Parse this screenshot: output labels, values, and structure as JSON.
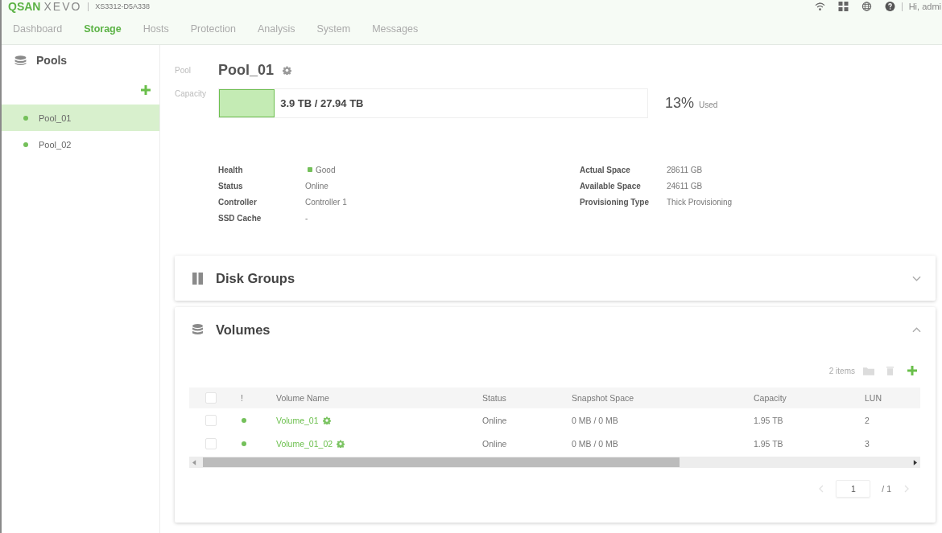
{
  "header": {
    "brand": "QSAN",
    "product": "XEVO",
    "serial": "XS3312-D5A338",
    "user": "Hi, admi"
  },
  "tabs": [
    {
      "label": "Dashboard",
      "selected": false
    },
    {
      "label": "Storage",
      "selected": true
    },
    {
      "label": "Hosts",
      "selected": false
    },
    {
      "label": "Protection",
      "selected": false
    },
    {
      "label": "Analysis",
      "selected": false
    },
    {
      "label": "System",
      "selected": false
    },
    {
      "label": "Messages",
      "selected": false
    }
  ],
  "sidebar": {
    "title": "Pools",
    "items": [
      {
        "label": "Pool_01",
        "selected": true,
        "color": "#74c05a"
      },
      {
        "label": "Pool_02",
        "selected": false,
        "color": "#74c05a"
      }
    ]
  },
  "pool": {
    "label": "Pool",
    "name": "Pool_01",
    "capacity_label": "Capacity",
    "capacity": {
      "level": 0.13,
      "text": "3.9 TB / 27.94 TB",
      "percent": "13%",
      "percent_label": "Used"
    }
  },
  "details": {
    "left": [
      {
        "label": "Health",
        "value": "Good",
        "color": "#74c05a"
      },
      {
        "label": "Status",
        "value": "Online"
      },
      {
        "label": "Controller",
        "value": "Controller 1"
      },
      {
        "label": "SSD Cache",
        "value": "-"
      }
    ],
    "right": [
      {
        "label": "Actual Space",
        "value": "28611 GB"
      },
      {
        "label": "Available Space",
        "value": "24611 GB"
      },
      {
        "label": "Provisioning Type",
        "value": "Thick Provisioning"
      }
    ]
  },
  "panels": [
    {
      "kind": "disk_groups",
      "title": "Disk Groups",
      "expanded": false
    },
    {
      "kind": "volumes",
      "title": "Volumes",
      "expanded": true,
      "toolbar": {
        "count": "2 items",
        "actions": [
          {
            "kind": "folder",
            "disabled": true
          },
          {
            "kind": "delete",
            "disabled": true
          },
          {
            "kind": "add",
            "disabled": false
          }
        ]
      },
      "table": {
        "select_all_checked": false,
        "columns": [
          "!",
          "Volume Name",
          "Status",
          "Snapshot Space",
          "Capacity",
          "LUN"
        ],
        "rows": [
          {
            "checked": false,
            "color": "#74c05a",
            "name": "Volume_01",
            "status": "Online",
            "snapshot_space": "0 MB / 0 MB",
            "capacity": "1.95 TB",
            "lun": "2"
          },
          {
            "checked": false,
            "color": "#74c05a",
            "name": "Volume_01_02",
            "status": "Online",
            "snapshot_space": "0 MB / 0 MB",
            "capacity": "1.95 TB",
            "lun": "3"
          }
        ]
      },
      "pagination": {
        "page": "1",
        "total": "/ 1",
        "prev_disabled": true,
        "next_disabled": true
      }
    }
  ]
}
